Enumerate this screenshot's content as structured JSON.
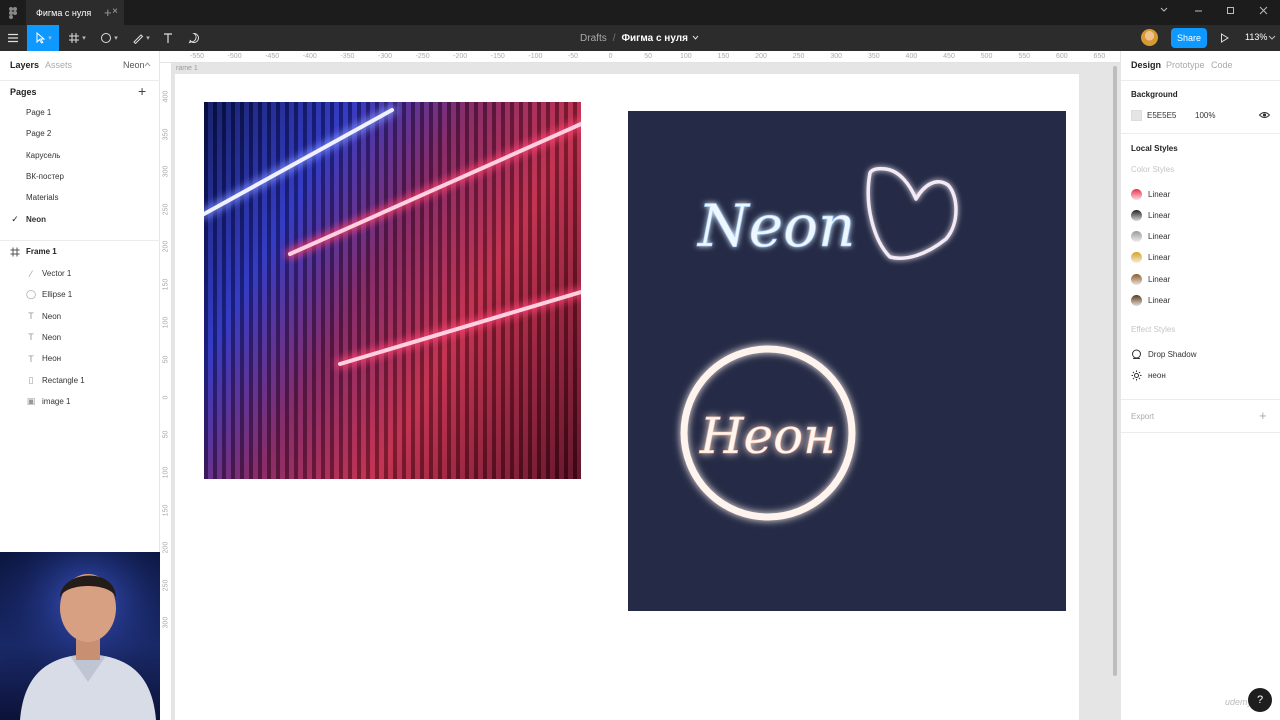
{
  "window": {
    "tab_title": "Фигма с нуля",
    "tab_close": "×",
    "new_tab": "+"
  },
  "toolbar": {
    "breadcrumb_drafts": "Drafts",
    "breadcrumb_sep": "/",
    "file_name": "Фигма с нуля",
    "share_label": "Share",
    "zoom": "113%"
  },
  "left_panel": {
    "tabs": {
      "layers": "Layers",
      "assets": "Assets",
      "page_selector": "Neon"
    },
    "pages_title": "Pages",
    "add_page": "+",
    "pages": [
      {
        "label": "Page 1",
        "current": false
      },
      {
        "label": "Page 2",
        "current": false
      },
      {
        "label": "Карусель",
        "current": false
      },
      {
        "label": "ВК-постер",
        "current": false
      },
      {
        "label": "Materials",
        "current": false
      },
      {
        "label": "Neon",
        "current": true
      }
    ],
    "frame_layer": "Frame 1",
    "layers": [
      {
        "label": "Vector 1",
        "icon": "vector-icon"
      },
      {
        "label": "Ellipse 1",
        "icon": "ellipse-icon"
      },
      {
        "label": "Neon",
        "icon": "text-icon"
      },
      {
        "label": "Neon",
        "icon": "text-icon"
      },
      {
        "label": "Неон",
        "icon": "text-icon"
      },
      {
        "label": "Rectangle 1",
        "icon": "rectangle-icon"
      },
      {
        "label": "image 1",
        "icon": "image-icon"
      }
    ]
  },
  "rulers": {
    "top": [
      "-550",
      "-500",
      "-450",
      "-400",
      "-350",
      "-300",
      "-250",
      "-200",
      "-150",
      "-100",
      "-50",
      "0",
      "50",
      "100",
      "150",
      "200",
      "250",
      "300",
      "350",
      "400",
      "450",
      "500",
      "550",
      "600",
      "650"
    ],
    "left": [
      "400",
      "350",
      "300",
      "250",
      "200",
      "150",
      "100",
      "50",
      "0",
      "50",
      "100",
      "150",
      "200",
      "250",
      "300"
    ]
  },
  "canvas": {
    "frame_label": "rame 1",
    "neon_text": "Neon",
    "neon_cyrillic": "Неон"
  },
  "right_panel": {
    "tabs": {
      "design": "Design",
      "prototype": "Prototype",
      "code": "Code"
    },
    "background_title": "Background",
    "bg_hex": "E5E5E5",
    "bg_opacity": "100%",
    "local_styles_title": "Local Styles",
    "color_styles_title": "Color Styles",
    "color_styles": [
      {
        "label": "Linear",
        "color": "#e8304c"
      },
      {
        "label": "Linear",
        "color": "#222222"
      },
      {
        "label": "Linear",
        "color": "#9a9a9a"
      },
      {
        "label": "Linear",
        "color": "#d4a020"
      },
      {
        "label": "Linear",
        "color": "#8a5a2a"
      },
      {
        "label": "Linear",
        "color": "#5a3a1a"
      }
    ],
    "effect_styles_title": "Effect Styles",
    "effect_styles": [
      {
        "label": "Drop Shadow",
        "icon": "drop-shadow-icon"
      },
      {
        "label": "неон",
        "icon": "sun-icon"
      }
    ],
    "export_title": "Export",
    "export_add": "+"
  },
  "overlay": {
    "help": "?",
    "watermark": "udemy"
  },
  "colors": {
    "accent": "#0d99ff",
    "artboard": "#252b46",
    "toolbar": "#2c2c2c"
  }
}
